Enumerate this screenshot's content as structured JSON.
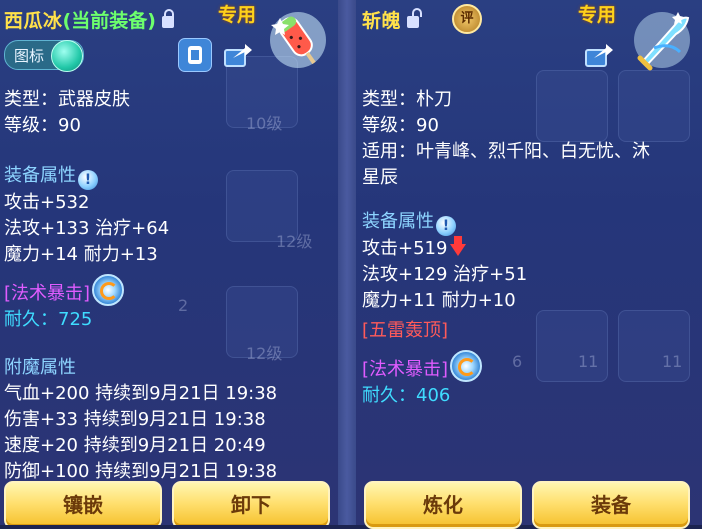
{
  "left": {
    "name": "西瓜冰",
    "equipped_tag": "(当前装备)",
    "exclusive": "专用",
    "icon_toggle_label": "图标",
    "attrs": [
      {
        "text": "类型：武器皮肤"
      },
      {
        "text": "等级：90"
      }
    ],
    "equip_section": "装备属性",
    "equip_stats": [
      {
        "text": "攻击+532"
      },
      {
        "text": "法攻+133 治疗+64"
      },
      {
        "text": "魔力+14 耐力+13"
      }
    ],
    "skill": "[法术暴击]",
    "durability": "耐久：725",
    "enchant_section": "附魔属性",
    "enchant_stats": [
      {
        "text": "气血+200 持续到9月21日 19:38"
      },
      {
        "text": "伤害+33 持续到9月21日 19:38"
      },
      {
        "text": "速度+20 持续到9月21日 20:49"
      },
      {
        "text": "防御+100 持续到9月21日 19:38"
      }
    ],
    "buttons": {
      "inlay": "镶嵌",
      "unequip": "卸下"
    },
    "ghost_labels": {
      "lv10": "10级",
      "lv12a": "12级",
      "lv12b": "12级",
      "n2": "2"
    }
  },
  "right": {
    "name": "斩魄",
    "badge": "评",
    "exclusive": "专用",
    "attrs": [
      {
        "text": "类型：朴刀"
      },
      {
        "text": "等级：90"
      },
      {
        "text": "适用：叶青峰、烈千阳、白无忧、沐"
      },
      {
        "text": "星辰"
      }
    ],
    "equip_section": "装备属性",
    "attack": "攻击+519",
    "equip_stats": [
      {
        "text": "法攻+129 治疗+51"
      },
      {
        "text": "魔力+11 耐力+10"
      }
    ],
    "special": "[五雷轰顶]",
    "skill": "[法术暴击]",
    "durability": "耐久：406",
    "buttons": {
      "refine": "炼化",
      "equip": "装备"
    },
    "ghost_labels": {
      "n6": "6",
      "n11a": "11",
      "n11b": "11"
    }
  },
  "colors": {
    "name": "#ffe14a",
    "section": "#8dd4ff",
    "skill": "#e05cff",
    "durability": "#3fdcff",
    "special": "#ff5a5a",
    "button": "#f5c02a"
  }
}
